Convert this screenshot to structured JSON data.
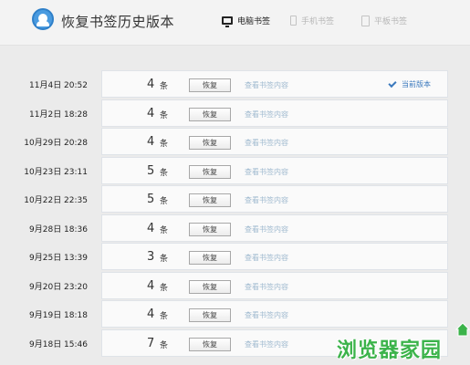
{
  "header": {
    "title": "恢复书签历史版本",
    "tabs": [
      {
        "label": "电脑书签",
        "icon": "monitor-icon",
        "active": true
      },
      {
        "label": "手机书签",
        "icon": "phone-icon",
        "active": false
      },
      {
        "label": "平板书签",
        "icon": "tablet-icon",
        "active": false
      }
    ]
  },
  "list": {
    "unit": "条",
    "restore_label": "恢复",
    "view_label": "查看书签内容",
    "current_label": "当前版本",
    "rows": [
      {
        "date": "11月4日 20:52",
        "count": "4"
      },
      {
        "date": "11月2日 18:28",
        "count": "4"
      },
      {
        "date": "10月29日 20:28",
        "count": "4"
      },
      {
        "date": "10月23日 23:11",
        "count": "5"
      },
      {
        "date": "10月22日 22:35",
        "count": "5"
      },
      {
        "date": "9月28日 18:36",
        "count": "4"
      },
      {
        "date": "9月25日 13:39",
        "count": "3"
      },
      {
        "date": "9月20日 23:20",
        "count": "4"
      },
      {
        "date": "9月19日 18:18",
        "count": "4"
      },
      {
        "date": "9月18日 15:46",
        "count": "7"
      }
    ]
  },
  "watermark": {
    "text": "浏览器家园"
  },
  "colors": {
    "accent": "#3b79bd",
    "link": "#9fb9cf",
    "watermark": "#3bb34a"
  }
}
